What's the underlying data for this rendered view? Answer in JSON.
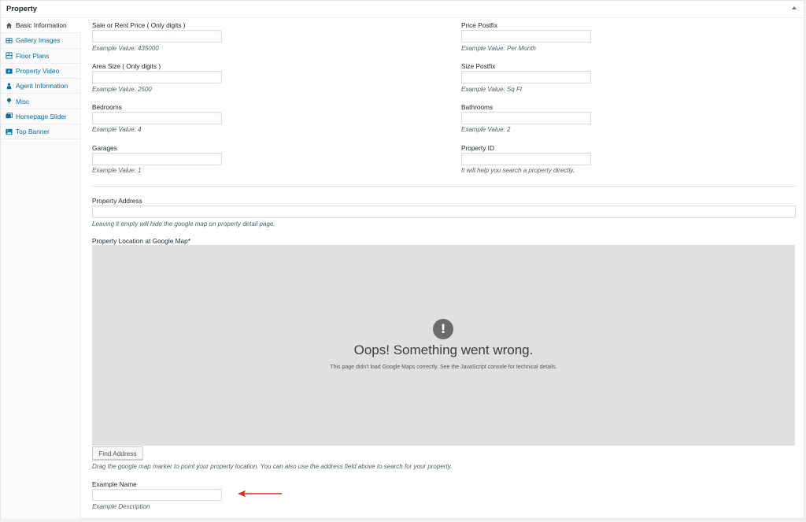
{
  "metabox": {
    "title": "Property"
  },
  "tabs": [
    {
      "label": "Basic Information",
      "icon": "home-icon"
    },
    {
      "label": "Gallery Images",
      "icon": "images-icon"
    },
    {
      "label": "Floor Plans",
      "icon": "floor-plans-icon"
    },
    {
      "label": "Property Video",
      "icon": "video-icon"
    },
    {
      "label": "Agent Information",
      "icon": "agent-icon"
    },
    {
      "label": "Misc",
      "icon": "pin-icon"
    },
    {
      "label": "Homepage Slider",
      "icon": "slider-icon"
    },
    {
      "label": "Top Banner",
      "icon": "banner-icon"
    }
  ],
  "fields": {
    "sale_price": {
      "label": "Sale or Rent Price ( Only digits )",
      "value": "",
      "hint": "Example Value: 435000"
    },
    "price_postfix": {
      "label": "Price Postfix",
      "value": "",
      "hint": "Example Value: Per Month"
    },
    "area_size": {
      "label": "Area Size ( Only digits )",
      "value": "",
      "hint": "Example Value: 2500"
    },
    "size_postfix": {
      "label": "Size Postfix",
      "value": "",
      "hint": "Example Value: Sq Ft"
    },
    "bedrooms": {
      "label": "Bedrooms",
      "value": "",
      "hint": "Example Value: 4"
    },
    "bathrooms": {
      "label": "Bathrooms",
      "value": "",
      "hint": "Example Value: 2"
    },
    "garages": {
      "label": "Garages",
      "value": "",
      "hint": "Example Value: 1"
    },
    "property_id": {
      "label": "Property ID",
      "value": "",
      "hint": "It will help you search a property directly."
    },
    "address": {
      "label": "Property Address",
      "value": "",
      "hint": "Leaving it empty will hide the google map on property detail page."
    },
    "example_name": {
      "label": "Example Name",
      "value": "",
      "hint": "Example Description"
    }
  },
  "map": {
    "label": "Property Location at Google Map*",
    "error_icon": "!",
    "error_title": "Oops! Something went wrong.",
    "error_detail": "This page didn't load Google Maps correctly. See the JavaScript console for technical details.",
    "find_button": "Find Address",
    "hint": "Drag the google map marker to point your property location. You can also use the address field above to search for your property."
  },
  "colors": {
    "link": "#0073aa",
    "annotation_arrow": "#e0281e",
    "map_bg": "#e0e0e0"
  }
}
